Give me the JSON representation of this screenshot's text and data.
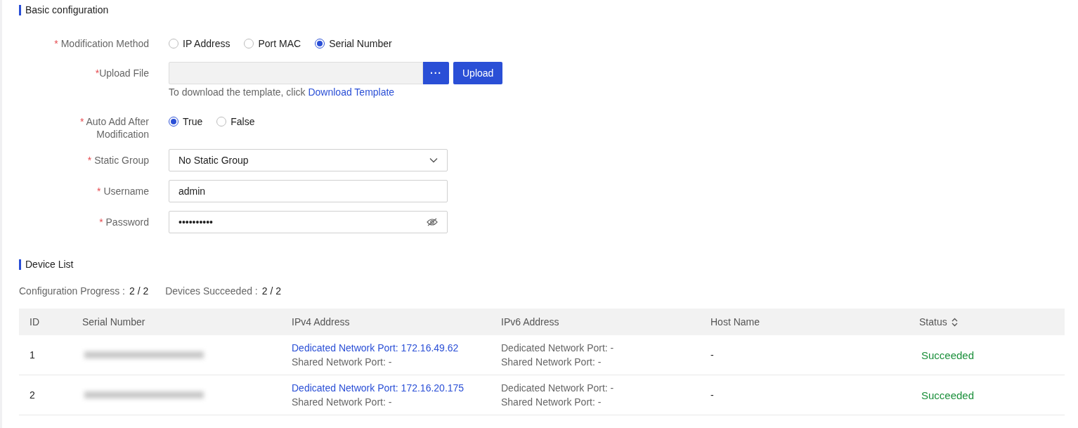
{
  "basic_configuration": {
    "title": "Basic configuration",
    "fields": [
      {
        "kind": "radio",
        "required_mark": "*",
        "label": "Modification Method",
        "options": [
          {
            "label": "IP Address",
            "selected": false
          },
          {
            "label": "Port MAC",
            "selected": false
          },
          {
            "label": "Serial Number",
            "selected": true
          }
        ]
      },
      {
        "kind": "file",
        "required_mark": "*",
        "label": "Upload File",
        "browse_button": "···",
        "upload_button": "Upload",
        "hint": "To download the template, click",
        "hint_link": "Download Template"
      },
      {
        "kind": "radio",
        "required_mark": "*",
        "label": "Auto Add After Modification",
        "options": [
          {
            "label": "True",
            "selected": true
          },
          {
            "label": "False",
            "selected": false
          }
        ]
      },
      {
        "kind": "select",
        "required_mark": "*",
        "label": "Static Group",
        "value": "No Static Group"
      },
      {
        "kind": "text",
        "required_mark": "*",
        "label": "Username",
        "value": "admin"
      },
      {
        "kind": "password",
        "required_mark": "*",
        "label": "Password",
        "value": "••••••••••"
      }
    ]
  },
  "device_list": {
    "title": "Device List",
    "progress": [
      {
        "label": "Configuration Progress :",
        "value": "2 / 2"
      },
      {
        "label": "Devices Succeeded :",
        "value": "2 / 2"
      }
    ],
    "table": {
      "columns": [
        "ID",
        "Serial Number",
        "IPv4 Address",
        "IPv6 Address",
        "Host Name",
        "Status"
      ],
      "rows": [
        {
          "id": "1",
          "ipv4": {
            "dedicated": "Dedicated Network Port: 172.16.49.62",
            "shared": "Shared Network Port: -"
          },
          "ipv6": {
            "dedicated": "Dedicated Network Port: -",
            "shared": "Shared Network Port: -"
          },
          "host_name": "-",
          "status": "Succeeded",
          "color": "#1a8f3a"
        },
        {
          "id": "2",
          "ipv4": {
            "dedicated": "Dedicated Network Port: 172.16.20.175",
            "shared": "Shared Network Port: -"
          },
          "ipv6": {
            "dedicated": "Dedicated Network Port: -",
            "shared": "Shared Network Port: -"
          },
          "host_name": "-",
          "status": "Succeeded",
          "color": "#1a8f3a"
        }
      ]
    }
  }
}
